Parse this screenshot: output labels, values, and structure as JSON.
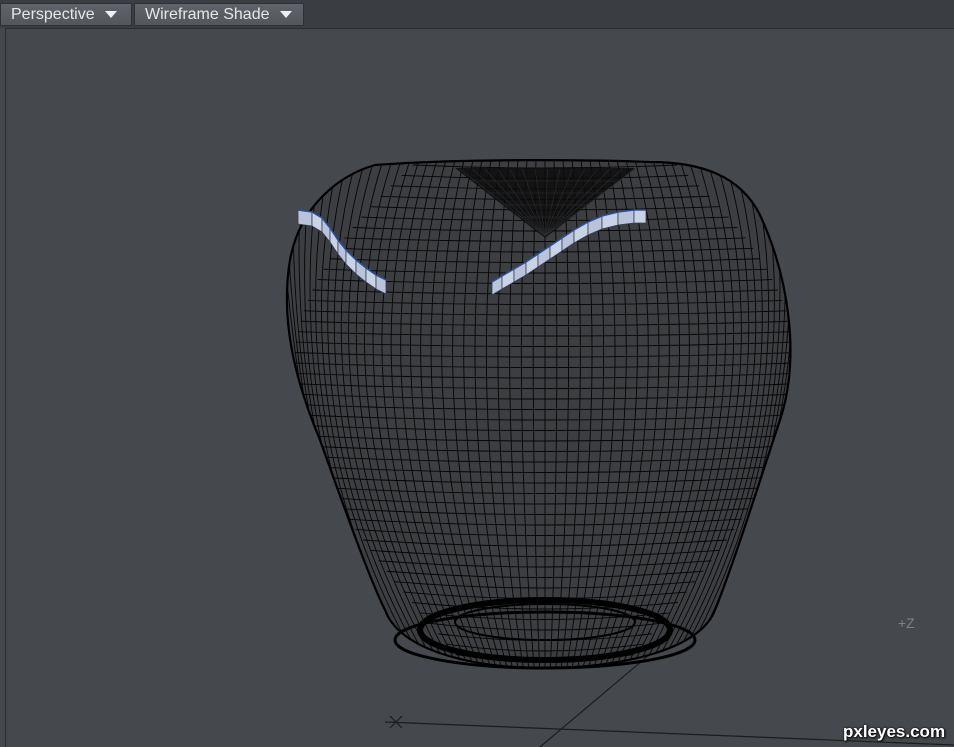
{
  "toolbar": {
    "view_mode": "Perspective",
    "shading_mode": "Wireframe Shade"
  },
  "viewport": {
    "axis_label": "+Z"
  },
  "watermark": "pxleyes.com",
  "colors": {
    "background": "#45484c",
    "wire": "#000000",
    "selection": "#c9d3e6",
    "selection_edge": "#2a4fa0"
  },
  "icons": {
    "dropdown_arrow": "chevron-down-icon"
  }
}
